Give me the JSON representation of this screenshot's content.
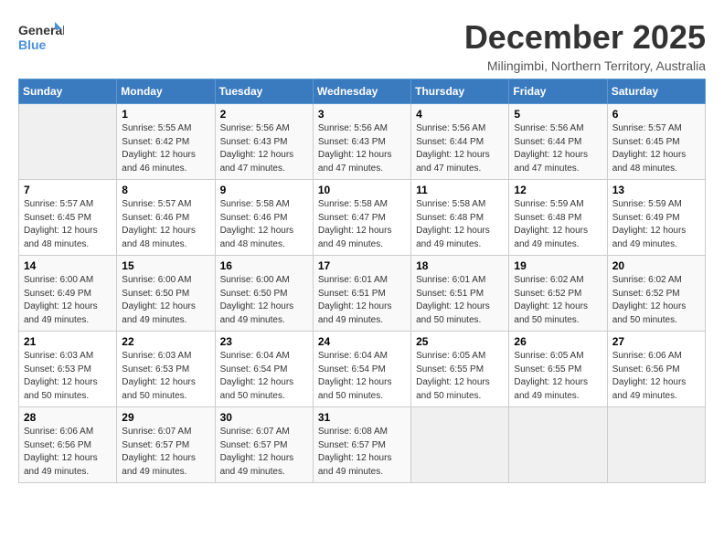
{
  "logo": {
    "line1": "General",
    "line2": "Blue"
  },
  "title": "December 2025",
  "location": "Milingimbi, Northern Territory, Australia",
  "headers": [
    "Sunday",
    "Monday",
    "Tuesday",
    "Wednesday",
    "Thursday",
    "Friday",
    "Saturday"
  ],
  "weeks": [
    [
      {
        "day": "",
        "text": ""
      },
      {
        "day": "1",
        "text": "Sunrise: 5:55 AM\nSunset: 6:42 PM\nDaylight: 12 hours\nand 46 minutes."
      },
      {
        "day": "2",
        "text": "Sunrise: 5:56 AM\nSunset: 6:43 PM\nDaylight: 12 hours\nand 47 minutes."
      },
      {
        "day": "3",
        "text": "Sunrise: 5:56 AM\nSunset: 6:43 PM\nDaylight: 12 hours\nand 47 minutes."
      },
      {
        "day": "4",
        "text": "Sunrise: 5:56 AM\nSunset: 6:44 PM\nDaylight: 12 hours\nand 47 minutes."
      },
      {
        "day": "5",
        "text": "Sunrise: 5:56 AM\nSunset: 6:44 PM\nDaylight: 12 hours\nand 47 minutes."
      },
      {
        "day": "6",
        "text": "Sunrise: 5:57 AM\nSunset: 6:45 PM\nDaylight: 12 hours\nand 48 minutes."
      }
    ],
    [
      {
        "day": "7",
        "text": "Sunrise: 5:57 AM\nSunset: 6:45 PM\nDaylight: 12 hours\nand 48 minutes."
      },
      {
        "day": "8",
        "text": "Sunrise: 5:57 AM\nSunset: 6:46 PM\nDaylight: 12 hours\nand 48 minutes."
      },
      {
        "day": "9",
        "text": "Sunrise: 5:58 AM\nSunset: 6:46 PM\nDaylight: 12 hours\nand 48 minutes."
      },
      {
        "day": "10",
        "text": "Sunrise: 5:58 AM\nSunset: 6:47 PM\nDaylight: 12 hours\nand 49 minutes."
      },
      {
        "day": "11",
        "text": "Sunrise: 5:58 AM\nSunset: 6:48 PM\nDaylight: 12 hours\nand 49 minutes."
      },
      {
        "day": "12",
        "text": "Sunrise: 5:59 AM\nSunset: 6:48 PM\nDaylight: 12 hours\nand 49 minutes."
      },
      {
        "day": "13",
        "text": "Sunrise: 5:59 AM\nSunset: 6:49 PM\nDaylight: 12 hours\nand 49 minutes."
      }
    ],
    [
      {
        "day": "14",
        "text": "Sunrise: 6:00 AM\nSunset: 6:49 PM\nDaylight: 12 hours\nand 49 minutes."
      },
      {
        "day": "15",
        "text": "Sunrise: 6:00 AM\nSunset: 6:50 PM\nDaylight: 12 hours\nand 49 minutes."
      },
      {
        "day": "16",
        "text": "Sunrise: 6:00 AM\nSunset: 6:50 PM\nDaylight: 12 hours\nand 49 minutes."
      },
      {
        "day": "17",
        "text": "Sunrise: 6:01 AM\nSunset: 6:51 PM\nDaylight: 12 hours\nand 49 minutes."
      },
      {
        "day": "18",
        "text": "Sunrise: 6:01 AM\nSunset: 6:51 PM\nDaylight: 12 hours\nand 50 minutes."
      },
      {
        "day": "19",
        "text": "Sunrise: 6:02 AM\nSunset: 6:52 PM\nDaylight: 12 hours\nand 50 minutes."
      },
      {
        "day": "20",
        "text": "Sunrise: 6:02 AM\nSunset: 6:52 PM\nDaylight: 12 hours\nand 50 minutes."
      }
    ],
    [
      {
        "day": "21",
        "text": "Sunrise: 6:03 AM\nSunset: 6:53 PM\nDaylight: 12 hours\nand 50 minutes."
      },
      {
        "day": "22",
        "text": "Sunrise: 6:03 AM\nSunset: 6:53 PM\nDaylight: 12 hours\nand 50 minutes."
      },
      {
        "day": "23",
        "text": "Sunrise: 6:04 AM\nSunset: 6:54 PM\nDaylight: 12 hours\nand 50 minutes."
      },
      {
        "day": "24",
        "text": "Sunrise: 6:04 AM\nSunset: 6:54 PM\nDaylight: 12 hours\nand 50 minutes."
      },
      {
        "day": "25",
        "text": "Sunrise: 6:05 AM\nSunset: 6:55 PM\nDaylight: 12 hours\nand 50 minutes."
      },
      {
        "day": "26",
        "text": "Sunrise: 6:05 AM\nSunset: 6:55 PM\nDaylight: 12 hours\nand 49 minutes."
      },
      {
        "day": "27",
        "text": "Sunrise: 6:06 AM\nSunset: 6:56 PM\nDaylight: 12 hours\nand 49 minutes."
      }
    ],
    [
      {
        "day": "28",
        "text": "Sunrise: 6:06 AM\nSunset: 6:56 PM\nDaylight: 12 hours\nand 49 minutes."
      },
      {
        "day": "29",
        "text": "Sunrise: 6:07 AM\nSunset: 6:57 PM\nDaylight: 12 hours\nand 49 minutes."
      },
      {
        "day": "30",
        "text": "Sunrise: 6:07 AM\nSunset: 6:57 PM\nDaylight: 12 hours\nand 49 minutes."
      },
      {
        "day": "31",
        "text": "Sunrise: 6:08 AM\nSunset: 6:57 PM\nDaylight: 12 hours\nand 49 minutes."
      },
      {
        "day": "",
        "text": ""
      },
      {
        "day": "",
        "text": ""
      },
      {
        "day": "",
        "text": ""
      }
    ]
  ]
}
